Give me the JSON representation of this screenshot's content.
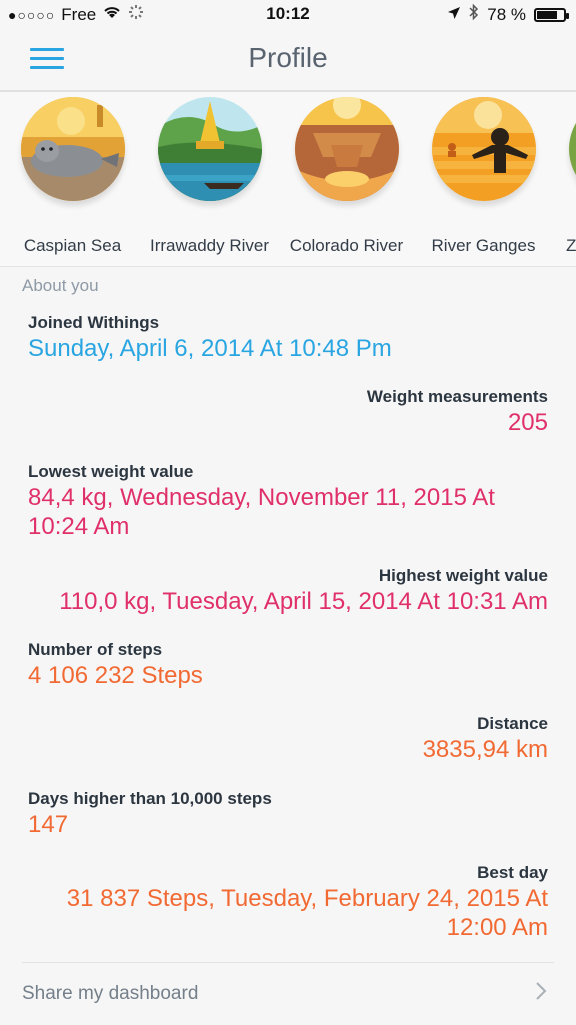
{
  "status": {
    "carrier": "Free",
    "time": "10:12",
    "battery": "78 %",
    "battery_level": 0.78
  },
  "header": {
    "title": "Profile"
  },
  "badges": [
    {
      "label": "Caspian Sea"
    },
    {
      "label": "Irrawaddy River"
    },
    {
      "label": "Colorado River"
    },
    {
      "label": "River Ganges"
    },
    {
      "label": "Z"
    }
  ],
  "about": {
    "title": "About you",
    "joined_label": "Joined Withings",
    "joined_value": "Sunday, April 6, 2014 At 10:48 Pm",
    "weight_meas_label": "Weight measurements",
    "weight_meas_value": "205",
    "lowest_label": "Lowest weight value",
    "lowest_value": "84,4 kg, Wednesday, November 11, 2015 At 10:24 Am",
    "highest_label": "Highest weight value",
    "highest_value": "110,0 kg, Tuesday, April 15, 2014 At 10:31 Am",
    "steps_label": "Number of steps",
    "steps_value": "4 106 232 Steps",
    "distance_label": "Distance",
    "distance_value": "3835,94 km",
    "days_label": "Days higher than 10,000 steps",
    "days_value": "147",
    "best_label": "Best day",
    "best_value": "31 837 Steps, Tuesday, February 24, 2015 At 12:00 Am"
  },
  "share": {
    "label": "Share my dashboard"
  },
  "colors": {
    "accent": "#29a5e2",
    "weight": "#e0306a",
    "activity": "#f26a33"
  }
}
